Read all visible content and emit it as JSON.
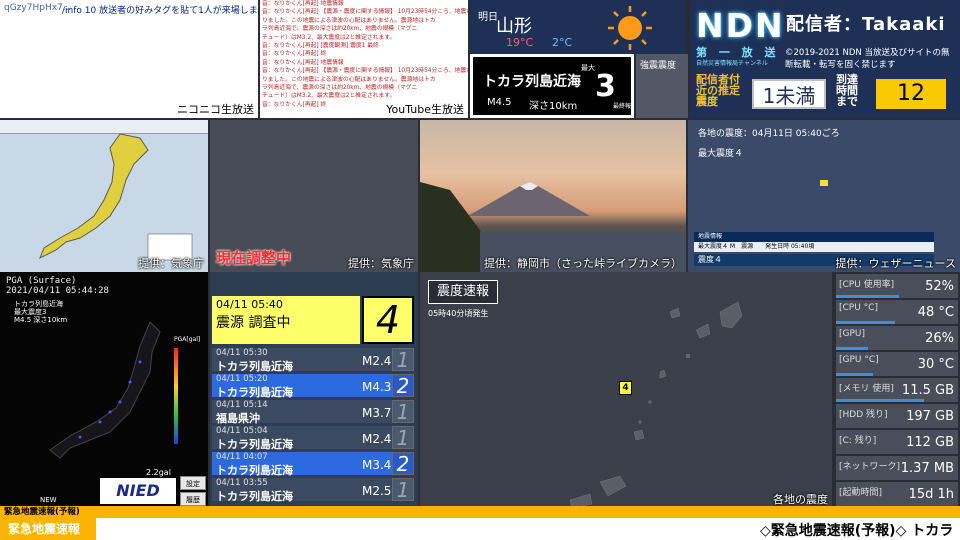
{
  "chat_niconico": {
    "user_id": "qGzy7HpHx7...",
    "message": "/info 10 放送者の好みタグを貼て1人が来場しました",
    "caption": "ニコニコ生放送"
  },
  "chat_youtube": {
    "lines": [
      "音：なりかくん[再起] 地震情報",
      "音：なりかくん[再起] 【震源・震度に関する情報】 10月23時54分ころ、地震があ",
      "りました。この地震による津波の心配はありません。震源地はトカ",
      "ラ列島近海で、震源の深さは約20km、地震の規模（マグニ",
      "チュード）はM3.2、最大震度は2と推定されます。",
      "音：なりかくん[再起] [震度観測] 震度1 最終",
      "音：なりかくん[再起] 終",
      "音：なりかくん[再起] 地震情報",
      "音：なりかくん[再起] 【震源・震度に関する情報】 10月23時54分ころ、地震があ",
      "りました。この地震による津波の心配はありません。震源地はトカ",
      "ラ列島近海で、震源の深さは約20km、地震の規模（マグニ",
      "チュード）はM3.2、最大震度は2と推定されます。",
      "音：なりかくん[再起] 終"
    ],
    "caption": "YouTube生放送"
  },
  "weather": {
    "label": "明日",
    "city": "山形",
    "high": "19°C",
    "low": "2°C"
  },
  "quake_box": {
    "area": "トカラ列島近海",
    "magnitude": "M4.5",
    "depth": "深さ10km",
    "max_label": "最大",
    "max_value": "3",
    "final": "最終報"
  },
  "strong_label": "強震震度",
  "header": {
    "logo": "NDN",
    "caster": "配信者：Takaaki",
    "sub": "第 一 放 送",
    "sub2": "自然災害情報局チャンネル",
    "copyright": "©2019-2021 NDN 当放送及びサイトの無断転載・転写を固く禁じます",
    "est_label": "配信者付近の推定震度",
    "est_value": "1未満",
    "arrive_label": "到達時間まで",
    "arrive_value": "12"
  },
  "panels": {
    "kishocho1": "提供：気象庁",
    "adjusting": "現在調整中",
    "kishocho2": "提供：気象庁",
    "camera": "提供：静岡市（さった峠ライブカメラ）",
    "weathernews": "提供：ウェザーニュース"
  },
  "weathernews": {
    "header": "各地の震度：04月11日 05:40ごろ",
    "max": "最大震度４",
    "bar1": "地震情報",
    "bar2": "最大震度４ M　震源　　発生日時 05:40頃",
    "bar3": "震度４"
  },
  "nied": {
    "pga": "PGA (Surface)",
    "time": "2021/04/11 05:44:28",
    "note1": "トカラ列島近海",
    "note2": "最大震度3",
    "note3": "M4.5 深さ10km",
    "gal": "2.2gal",
    "new": "NEW",
    "logo": "NIED",
    "settings": "設定",
    "history": "履歴",
    "pga_unit": "PGA[gal]"
  },
  "current": {
    "time": "04/11 05:40",
    "place": "震源 調査中",
    "intensity": "4"
  },
  "history_rows": [
    {
      "time": "04/11 05:30",
      "place": "トカラ列島近海",
      "mag": "M2.4",
      "int": "1"
    },
    {
      "time": "04/11 05:20",
      "place": "トカラ列島近海",
      "mag": "M4.3",
      "int": "2"
    },
    {
      "time": "04/11 05:14",
      "place": "福島県沖",
      "mag": "M3.7",
      "int": "1"
    },
    {
      "time": "04/11 05:04",
      "place": "トカラ列島近海",
      "mag": "M2.4",
      "int": "1"
    },
    {
      "time": "04/11 04:07",
      "place": "トカラ列島近海",
      "mag": "M3.4",
      "int": "2"
    },
    {
      "time": "04/11 03:55",
      "place": "トカラ列島近海",
      "mag": "M2.5",
      "int": "1"
    }
  ],
  "bigmap": {
    "title": "震度速報",
    "occurred": "05時40分頃発生",
    "badge": "4",
    "caption": "各地の震度"
  },
  "stats": [
    {
      "label": "[CPU 使用率]",
      "value": "52%",
      "level": 0.52
    },
    {
      "label": "[CPU °C]",
      "value": "48 °C",
      "level": 0.48
    },
    {
      "label": "[GPU]",
      "value": "26%",
      "level": 0.26
    },
    {
      "label": "[GPU °C]",
      "value": "30 °C",
      "level": 0.3
    },
    {
      "label": "[メモリ 使用]",
      "value": "11.5 GB",
      "level": 0.72
    },
    {
      "label": "[HDD 残り]",
      "value": "197 GB",
      "level": 0.0
    },
    {
      "label": "[C: 残り]",
      "value": "112 GB",
      "level": 0.0
    },
    {
      "label": "[ネットワーク]",
      "value": "1.37 MB",
      "level": 0.0
    },
    {
      "label": "[起動時間]",
      "value": "15d 1h",
      "level": 0.0
    }
  ],
  "ticker": {
    "top": "緊急地震速報(予報)",
    "label": "緊急地震速報",
    "scroll": "◇緊急地震速報(予報)◇ トカラ"
  },
  "colors": {
    "navy": "#1f3057",
    "yellow": "#ffff6a",
    "blue_row": "#2d6ae0",
    "orange": "#f8b400"
  }
}
